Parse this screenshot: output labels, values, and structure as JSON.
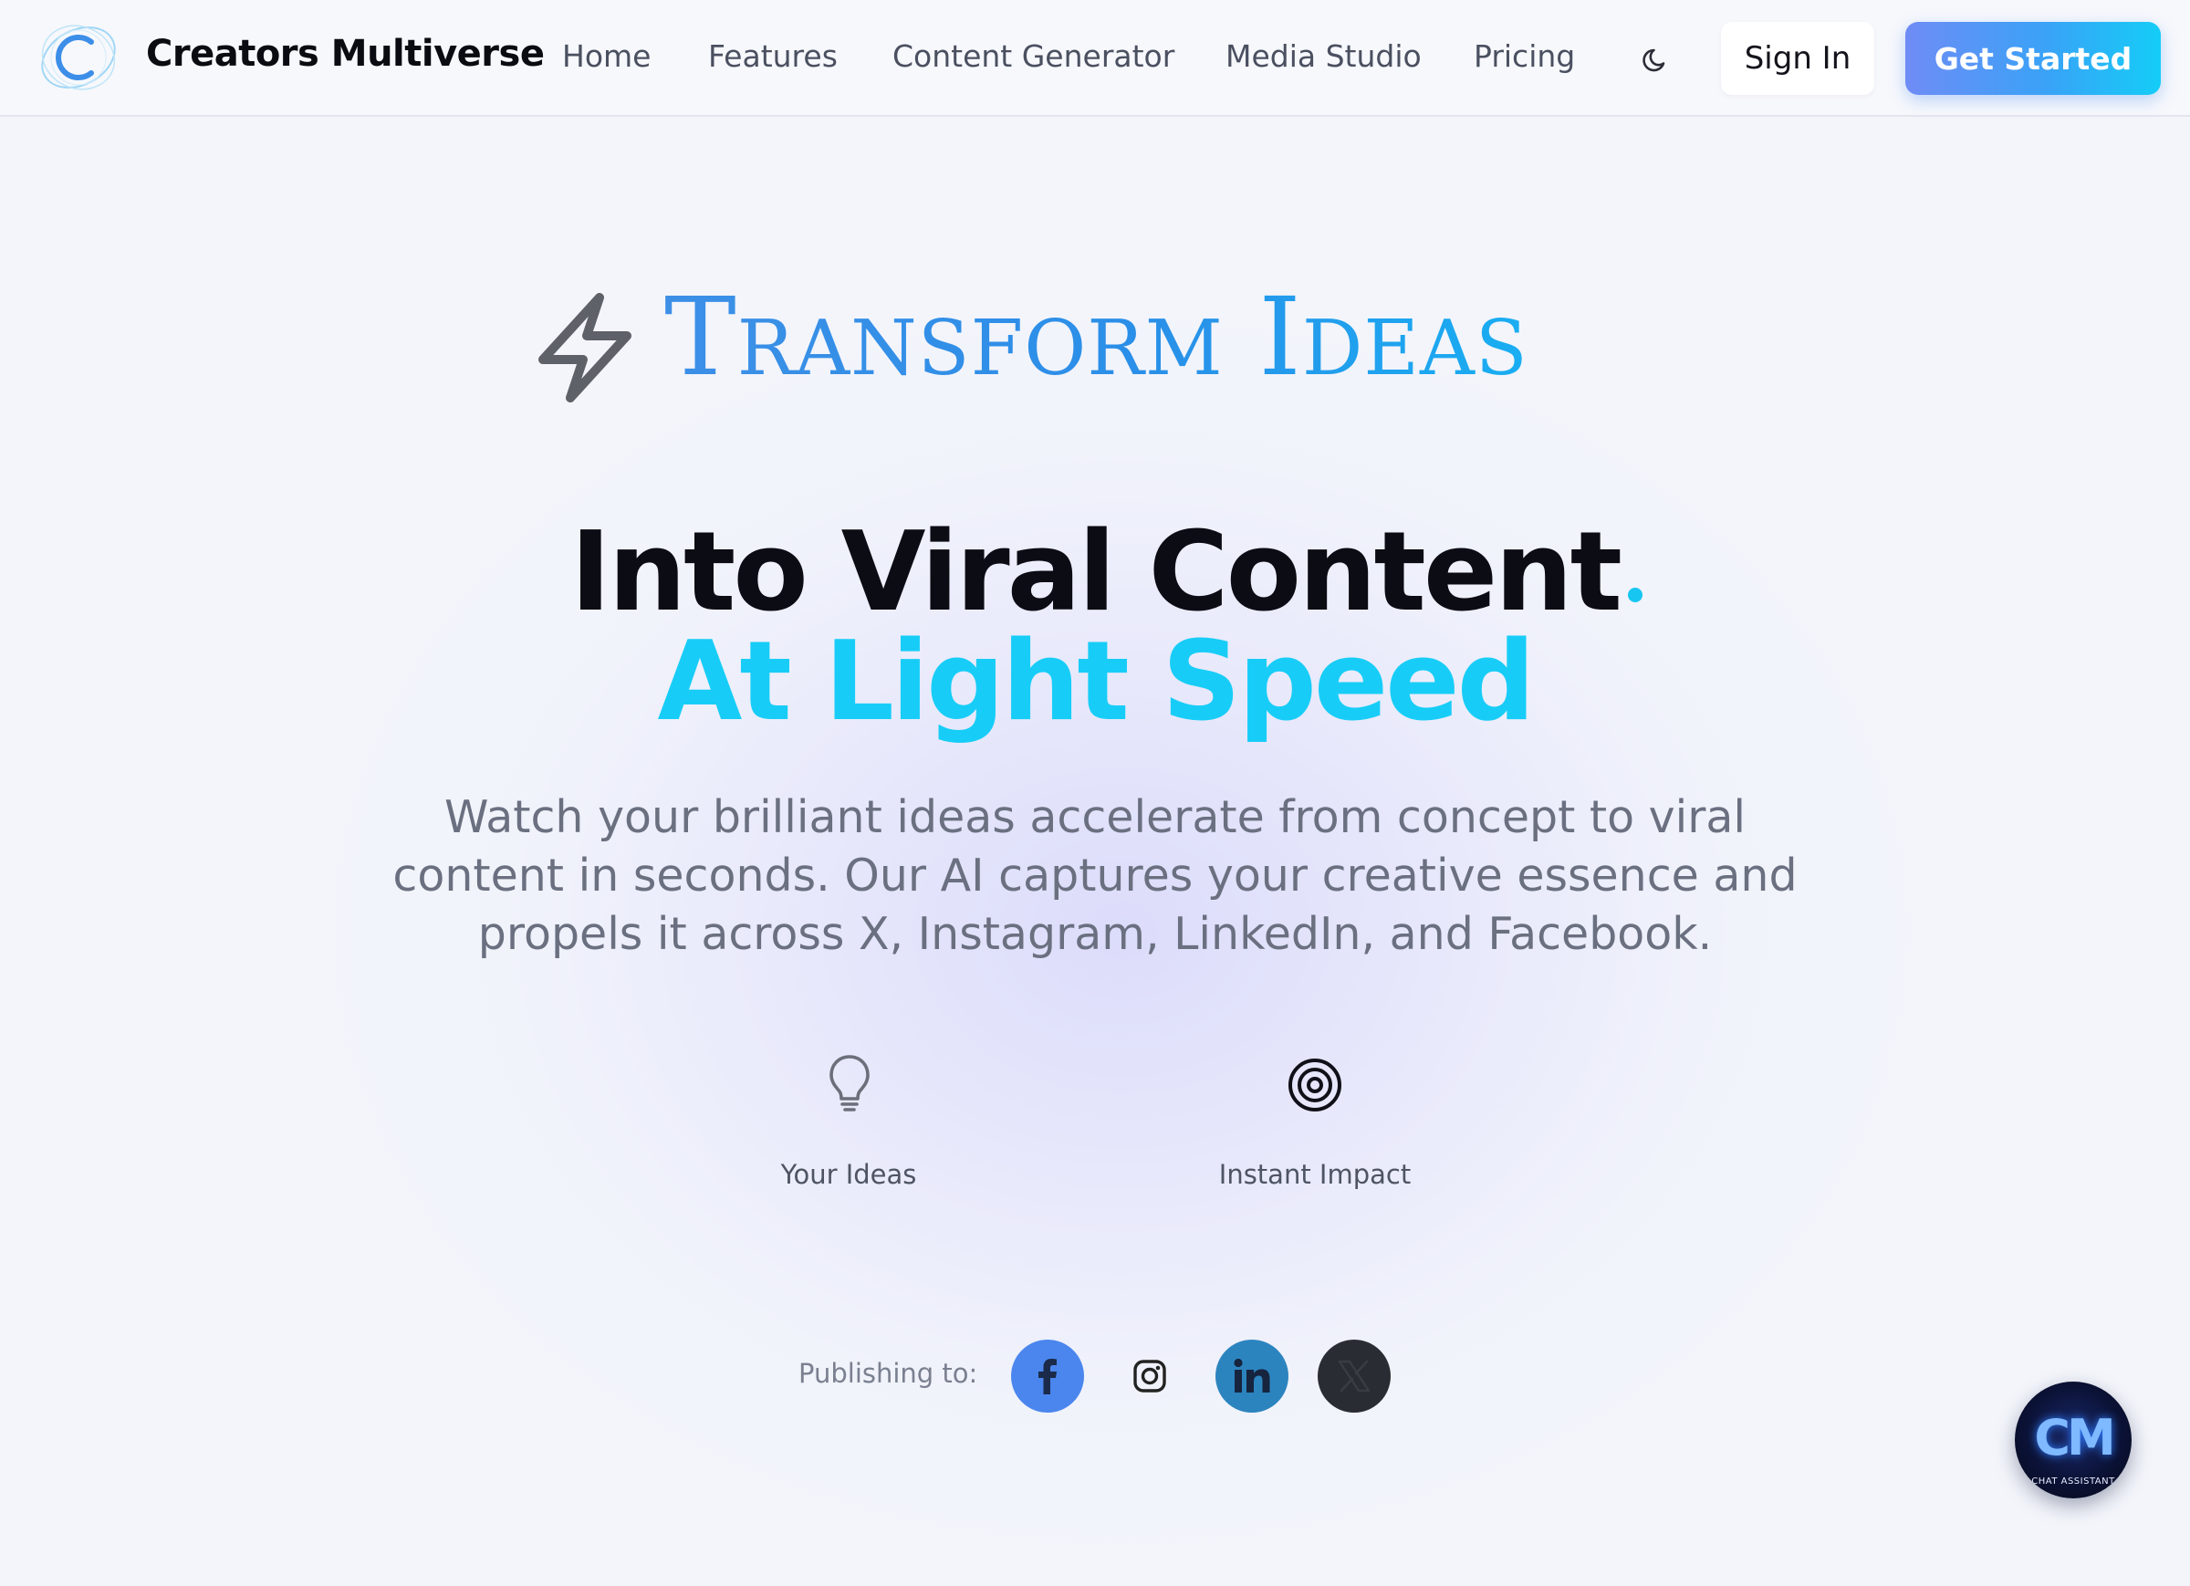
{
  "header": {
    "brand": "Creators Multiverse",
    "nav": [
      "Home",
      "Features",
      "Content Generator",
      "Media Studio",
      "Pricing"
    ],
    "sign_in": "Sign In",
    "get_started": "Get Started",
    "theme_icon": "moon-icon"
  },
  "hero": {
    "tagline": "Transform Ideas",
    "tag_icon": "lightning-bolt-icon",
    "headline_1": "Into Viral Content",
    "headline_2": "At Light Speed",
    "description": "Watch your brilliant ideas accelerate from concept to viral content in seconds. Our AI captures your creative essence and propels it across X, Instagram, LinkedIn, and Facebook.",
    "features": [
      {
        "label": "Your Ideas",
        "icon": "lightbulb-icon"
      },
      {
        "label": "Instant Impact",
        "icon": "target-icon"
      }
    ]
  },
  "publishing": {
    "label": "Publishing to:",
    "platforms": [
      {
        "name": "facebook",
        "icon": "facebook-icon",
        "color": "#4a86ee"
      },
      {
        "name": "instagram",
        "icon": "instagram-icon",
        "color": "#222222"
      },
      {
        "name": "linkedin",
        "icon": "linkedin-icon",
        "color": "#2c84bf"
      },
      {
        "name": "x",
        "icon": "x-icon",
        "color": "#2a2c33"
      }
    ]
  },
  "chat": {
    "letters": "CM",
    "subtitle": "CHAT ASSISTANT"
  },
  "colors": {
    "accent_cyan": "#17cdf7",
    "accent_blue": "#3a8fe8",
    "button_gradient_start": "#6f8cf5",
    "button_gradient_end": "#14cdf7"
  }
}
